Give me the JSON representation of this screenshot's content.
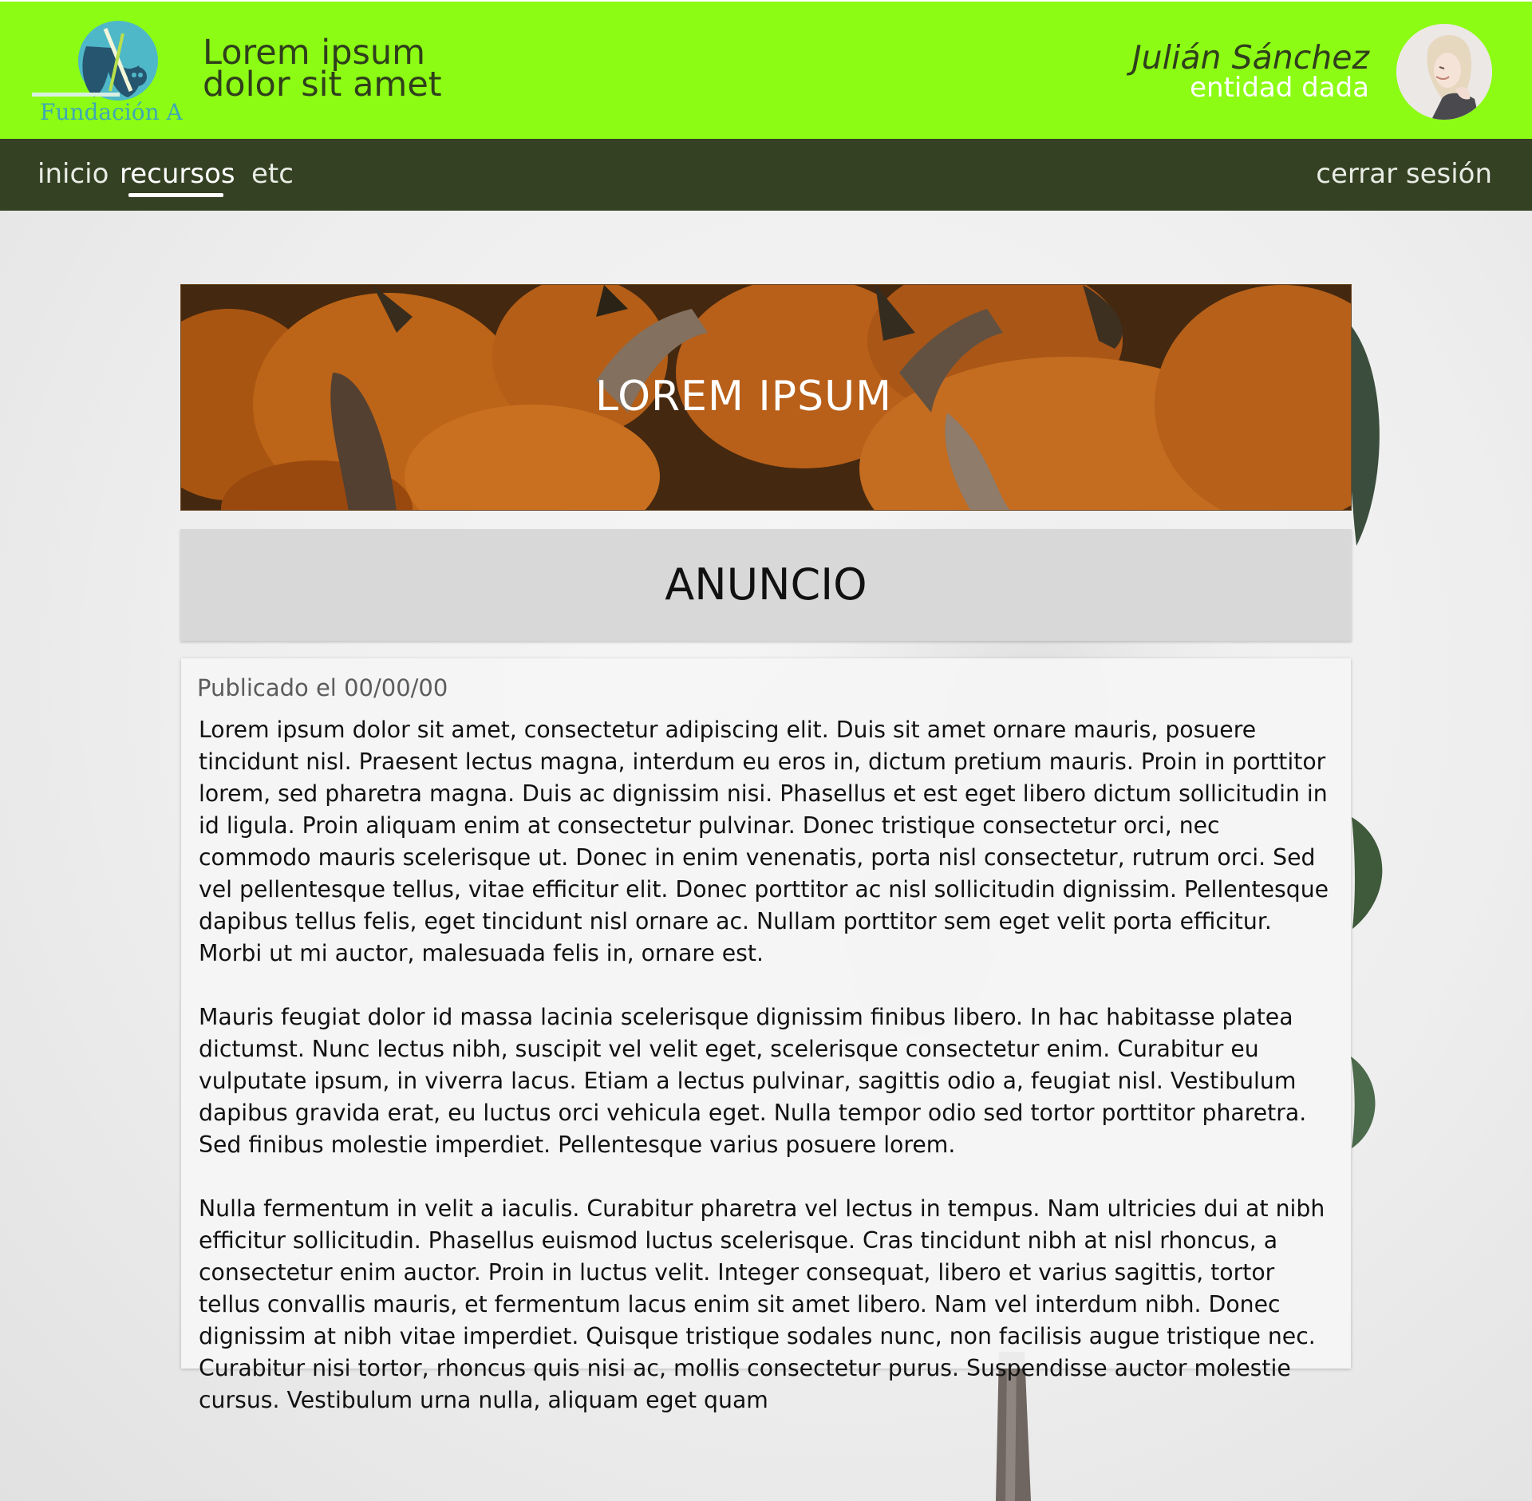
{
  "header": {
    "logo_text": "Fundación A",
    "site_title_line1": "Lorem ipsum",
    "site_title_line2": "dolor sit amet",
    "user_name": "Julián Sánchez",
    "user_entity": "entidad dada",
    "brand_color": "#8cfc14"
  },
  "nav": {
    "items": [
      {
        "label": "inicio",
        "active": false
      },
      {
        "label": "recursos",
        "active": true
      },
      {
        "label": "etc",
        "active": false
      }
    ],
    "logout_label": "cerrar sesión",
    "bg_color": "#344123"
  },
  "banner": {
    "title": "LOREM IPSUM"
  },
  "announcement": {
    "heading": "ANUNCIO",
    "published": "Publicado el 00/00/00",
    "paragraphs": [
      "Lorem ipsum dolor sit amet, consectetur adipiscing elit. Duis sit amet ornare mauris, posuere tincidunt nisl. Praesent lectus magna, interdum eu eros in, dictum pretium mauris. Proin in porttitor lorem, sed pharetra magna. Duis ac dignissim nisi. Phasellus et est eget libero dictum sollicitudin in id ligula. Proin aliquam enim at consectetur pulvinar. Donec tristique consectetur orci, nec commodo mauris scelerisque ut. Donec in enim venenatis, porta nisl consectetur, rutrum orci. Sed vel pellentesque tellus, vitae efficitur elit. Donec porttitor ac nisl sollicitudin dignissim. Pellentesque dapibus tellus felis, eget tincidunt nisl ornare ac. Nullam porttitor sem eget velit porta efficitur. Morbi ut mi auctor, malesuada felis in, ornare est.",
      "Mauris feugiat dolor id massa lacinia scelerisque dignissim finibus libero. In hac habitasse platea dictumst. Nunc lectus nibh, suscipit vel velit eget, scelerisque consectetur enim. Curabitur eu vulputate ipsum, in viverra lacus. Etiam a lectus pulvinar, sagittis odio a, feugiat nisl. Vestibulum dapibus gravida erat, eu luctus orci vehicula eget. Nulla tempor odio sed tortor porttitor pharetra. Sed finibus molestie imperdiet. Pellentesque varius posuere lorem.",
      "Nulla fermentum in velit a iaculis. Curabitur pharetra vel lectus in tempus. Nam ultricies dui at nibh efficitur sollicitudin. Phasellus euismod luctus scelerisque. Cras tincidunt nibh at nisl rhoncus, a consectetur enim auctor. Proin in luctus velit. Integer consequat, libero et varius sagittis, tortor tellus convallis mauris, et fermentum lacus enim sit amet libero. Nam vel interdum nibh. Donec dignissim at nibh vitae imperdiet. Quisque tristique sodales nunc, non facilisis augue tristique nec. Curabitur nisi tortor, rhoncus quis nisi ac, mollis consectetur purus. Suspendisse auctor molestie cursus. Vestibulum urna nulla, aliquam eget quam"
    ]
  }
}
